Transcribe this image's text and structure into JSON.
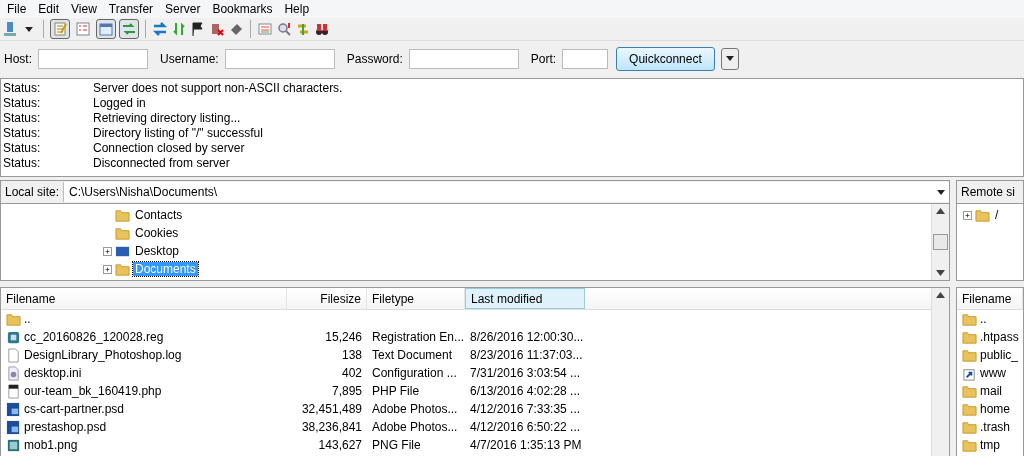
{
  "menu": [
    "File",
    "Edit",
    "View",
    "Transfer",
    "Server",
    "Bookmarks",
    "Help"
  ],
  "toolbar": {
    "toggles": [
      {
        "on": true
      },
      {
        "on": false
      },
      {
        "on": true
      },
      {
        "on": true
      }
    ]
  },
  "quickconnect": {
    "fields": [
      {
        "label": "Host:"
      },
      {
        "label": "Username:"
      },
      {
        "label": "Password:"
      },
      {
        "label": "Port:"
      }
    ],
    "button": "Quickconnect"
  },
  "log": [
    {
      "type": "Status:",
      "message": "Server does not support non-ASCII characters."
    },
    {
      "type": "Status:",
      "message": "Logged in"
    },
    {
      "type": "Status:",
      "message": "Retrieving directory listing..."
    },
    {
      "type": "Status:",
      "message": "Directory listing of \"/\" successful"
    },
    {
      "type": "Status:",
      "message": "Connection closed by server"
    },
    {
      "type": "Status:",
      "message": "Disconnected from server"
    }
  ],
  "local": {
    "label": "Local site:",
    "path": "C:\\Users\\Nisha\\Documents\\",
    "tree": [
      {
        "name": "Contacts",
        "kind": "folder",
        "expandable": false,
        "selected": false
      },
      {
        "name": "Cookies",
        "kind": "folder",
        "expandable": false,
        "selected": false
      },
      {
        "name": "Desktop",
        "kind": "desktop",
        "expandable": true,
        "selected": false
      },
      {
        "name": "Documents",
        "kind": "docs",
        "expandable": true,
        "selected": true
      }
    ],
    "columns": [
      {
        "label": "Filename",
        "sorted": false
      },
      {
        "label": "Filesize",
        "sorted": false
      },
      {
        "label": "Filetype",
        "sorted": false
      },
      {
        "label": "Last modified",
        "sorted": true
      }
    ],
    "rows": [
      {
        "kind": "folder",
        "name": ".."
      },
      {
        "kind": "reg",
        "name": "cc_20160826_120028.reg",
        "size": "15,246",
        "type": "Registration En...",
        "modified": "8/26/2016 12:00:30..."
      },
      {
        "kind": "text",
        "name": "DesignLibrary_Photoshop.log",
        "size": "138",
        "type": "Text Document",
        "modified": "8/23/2016 11:37:03..."
      },
      {
        "kind": "config",
        "name": "desktop.ini",
        "size": "402",
        "type": "Configuration ...",
        "modified": "7/31/2016 3:03:54 ..."
      },
      {
        "kind": "php",
        "name": "our-team_bk_160419.php",
        "size": "7,895",
        "type": "PHP File",
        "modified": "6/13/2016 4:02:28 ..."
      },
      {
        "kind": "psd",
        "name": "cs-cart-partner.psd",
        "size": "32,451,489",
        "type": "Adobe Photos...",
        "modified": "4/12/2016 7:33:35 ..."
      },
      {
        "kind": "psd",
        "name": "prestashop.psd",
        "size": "38,236,841",
        "type": "Adobe Photos...",
        "modified": "4/12/2016 6:50:22 ..."
      },
      {
        "kind": "png",
        "name": "mob1.png",
        "size": "143,627",
        "type": "PNG File",
        "modified": "4/7/2016 1:35:13 PM"
      }
    ]
  },
  "remote": {
    "label": "Remote si",
    "tree": [
      {
        "name": "/",
        "expandable": true
      }
    ],
    "columns": [
      {
        "label": "Filename"
      }
    ],
    "rows": [
      {
        "kind": "folder",
        "name": ".."
      },
      {
        "kind": "folder",
        "name": ".htpass"
      },
      {
        "kind": "folder",
        "name": "public_"
      },
      {
        "kind": "link",
        "name": "www"
      },
      {
        "kind": "folder",
        "name": "mail"
      },
      {
        "kind": "folder",
        "name": "home"
      },
      {
        "kind": "folder",
        "name": ".trash"
      },
      {
        "kind": "folder",
        "name": "tmp"
      }
    ]
  }
}
